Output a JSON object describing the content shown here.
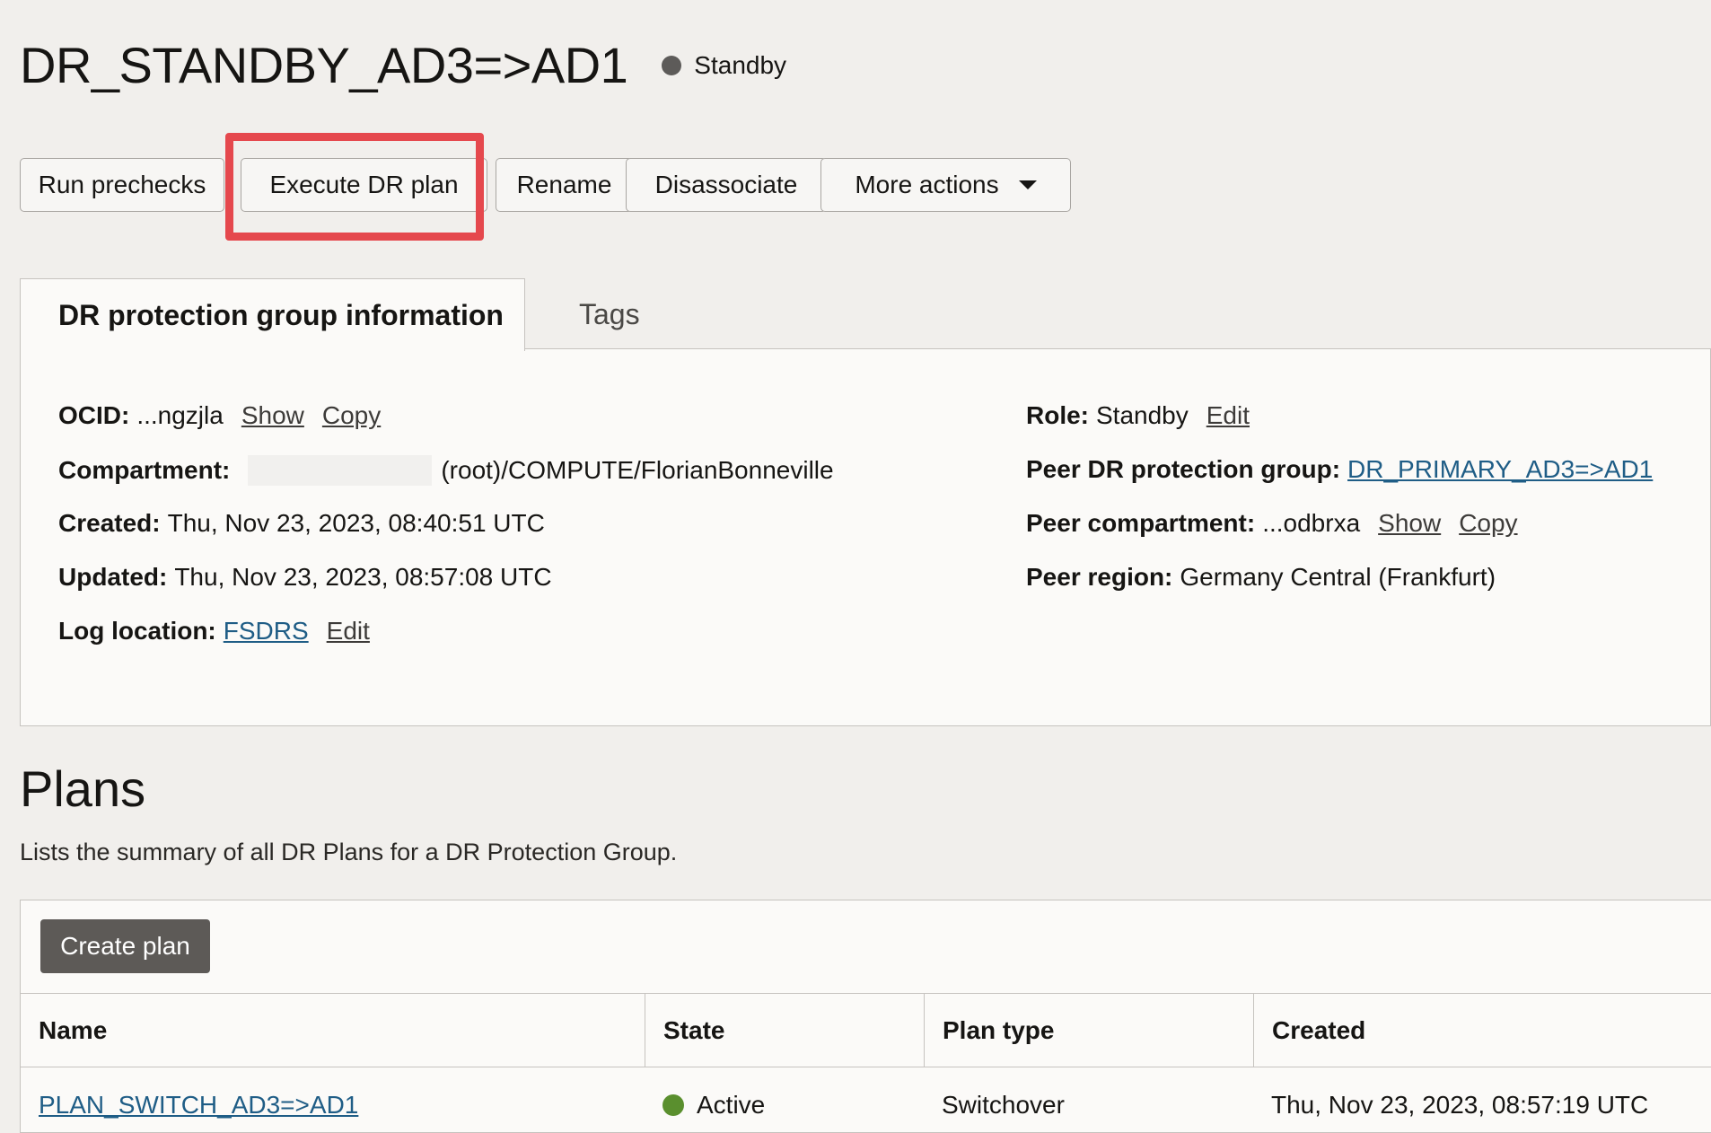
{
  "header": {
    "title": "DR_STANDBY_AD3=>AD1",
    "status": "Standby",
    "status_color": "#5d5b59"
  },
  "actions": {
    "run_prechecks": "Run prechecks",
    "execute_dr_plan": "Execute DR plan",
    "rename": "Rename",
    "disassociate": "Disassociate",
    "more_actions": "More actions"
  },
  "tabs": {
    "active": "DR protection group information",
    "tags": "Tags"
  },
  "info": {
    "ocid_label": "OCID:",
    "ocid_value": "...ngzjla",
    "show": "Show",
    "copy": "Copy",
    "compartment_label": "Compartment:",
    "compartment_value": "(root)/COMPUTE/FlorianBonneville",
    "created_label": "Created:",
    "created_value": "Thu, Nov 23, 2023, 08:40:51 UTC",
    "updated_label": "Updated:",
    "updated_value": "Thu, Nov 23, 2023, 08:57:08 UTC",
    "log_label": "Log location:",
    "log_value": "FSDRS",
    "edit": "Edit",
    "role_label": "Role:",
    "role_value": "Standby",
    "peer_group_label": "Peer DR protection group:",
    "peer_group_value": "DR_PRIMARY_AD3=>AD1",
    "peer_compartment_label": "Peer compartment:",
    "peer_compartment_value": "...odbrxa",
    "peer_region_label": "Peer region:",
    "peer_region_value": "Germany Central (Frankfurt)"
  },
  "plans": {
    "title": "Plans",
    "description": "Lists the summary of all DR Plans for a DR Protection Group.",
    "create_button": "Create plan",
    "columns": [
      "Name",
      "State",
      "Plan type",
      "Created"
    ],
    "rows": [
      {
        "name": "PLAN_SWITCH_AD3=>AD1",
        "state": "Active",
        "state_color": "#5a8f2e",
        "plan_type": "Switchover",
        "created": "Thu, Nov 23, 2023, 08:57:19 UTC"
      }
    ]
  },
  "colors": {
    "highlight": "#e5484d",
    "link": "#1f5d86",
    "primary_button": "#5d5a57"
  }
}
